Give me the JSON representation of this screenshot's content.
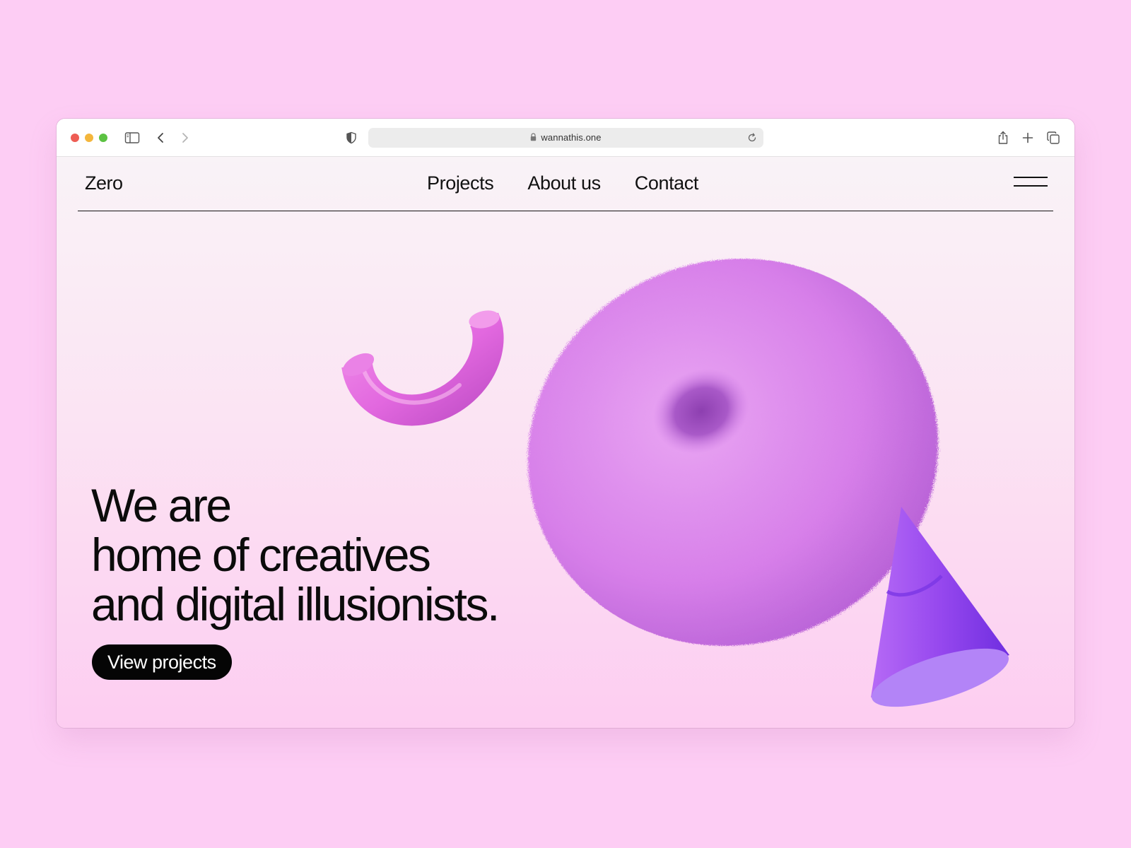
{
  "browser": {
    "url": "wannathis.one",
    "icons": [
      "sidebar-icon",
      "back-icon",
      "forward-icon",
      "shield-icon",
      "lock-icon",
      "reload-icon",
      "share-icon",
      "new-tab-icon",
      "tabs-overview-icon"
    ]
  },
  "site": {
    "logo": "Zero",
    "nav": [
      {
        "label": "Projects"
      },
      {
        "label": "About us"
      },
      {
        "label": "Contact"
      }
    ]
  },
  "hero": {
    "lines": [
      "We are",
      "home of creatives",
      "and digital illusionists."
    ],
    "cta_label": "View projects"
  },
  "colors": {
    "page_background": "#fdcdf4",
    "text": "#0b0b0b",
    "button": "#050505",
    "fuzzy_torus": "#d57ce8",
    "arc_shape": "#e86ae2",
    "cone": "#9a4cf0"
  }
}
